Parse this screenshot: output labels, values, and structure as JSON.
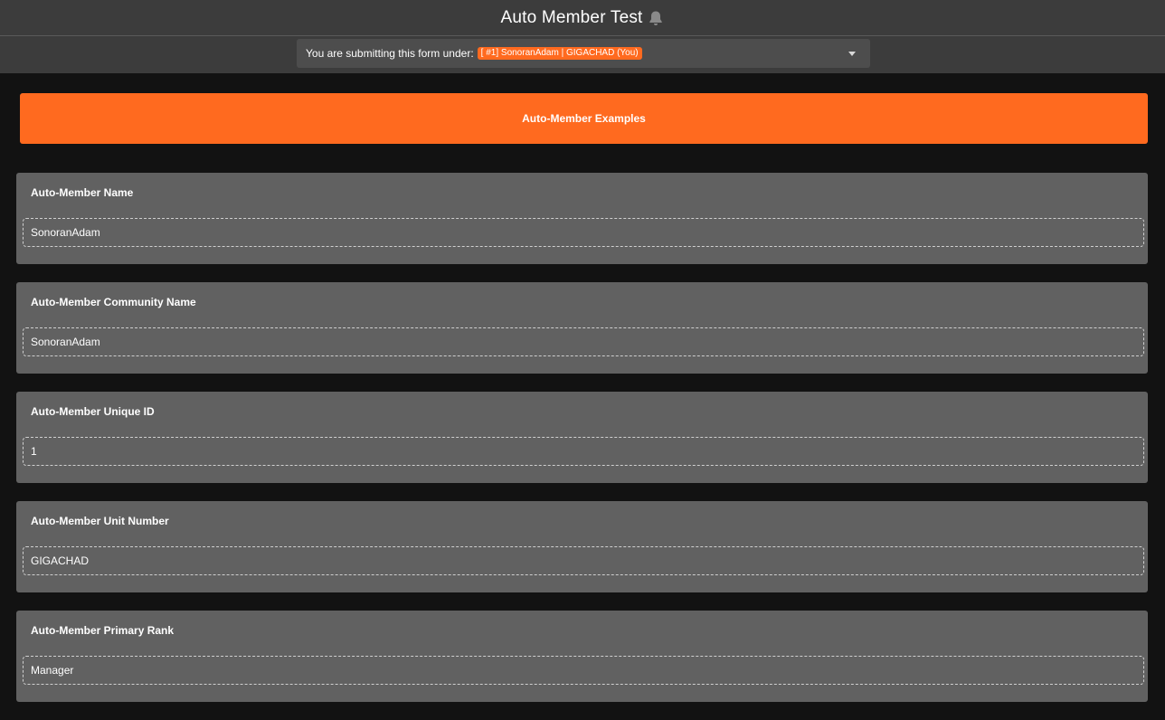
{
  "header": {
    "title": "Auto Member Test",
    "notification_icon": "bell-icon"
  },
  "submitter": {
    "prefix": "You are submitting this form under:",
    "selected": "[ #1] SonoranAdam | GIGACHAD (You)"
  },
  "section": {
    "title": "Auto-Member Examples"
  },
  "fields": [
    {
      "label": "Auto-Member Name",
      "value": "SonoranAdam"
    },
    {
      "label": "Auto-Member Community Name",
      "value": "SonoranAdam"
    },
    {
      "label": "Auto-Member Unique ID",
      "value": "1"
    },
    {
      "label": "Auto-Member Unit Number",
      "value": "GIGACHAD"
    },
    {
      "label": "Auto-Member Primary Rank",
      "value": "Manager"
    }
  ],
  "colors": {
    "accent": "#ff6a1f",
    "background": "#121212",
    "card": "#616161",
    "topbar": "#3c3c3c"
  }
}
